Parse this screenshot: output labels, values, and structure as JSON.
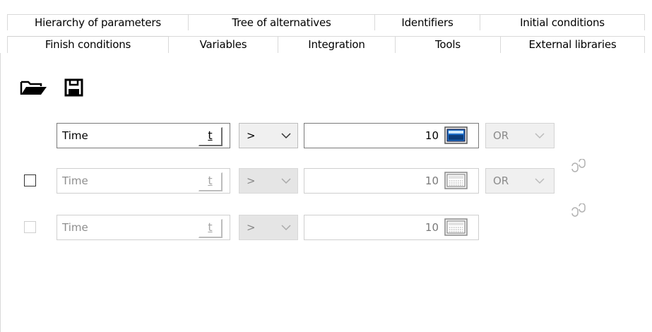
{
  "tabs": {
    "row1": [
      {
        "label": "Hierarchy of parameters"
      },
      {
        "label": "Tree of alternatives"
      },
      {
        "label": "Identifiers"
      },
      {
        "label": "Initial conditions"
      }
    ],
    "row2": [
      {
        "label": "Finish conditions",
        "active": true
      },
      {
        "label": "Variables"
      },
      {
        "label": "Integration"
      },
      {
        "label": "Tools"
      },
      {
        "label": "External libraries"
      }
    ]
  },
  "toolbar": {
    "open_icon": "open-folder-icon",
    "save_icon": "save-disk-icon"
  },
  "conditions": [
    {
      "checkbox_shown": false,
      "variable": "Time",
      "var_button": "t",
      "operator": "&gt;",
      "value": "10",
      "logic": "OR",
      "enabled": true
    },
    {
      "checkbox_shown": true,
      "checked": false,
      "variable": "Time",
      "var_button": "t",
      "operator": "&gt;",
      "value": "10",
      "logic": "OR",
      "enabled": false
    },
    {
      "checkbox_shown": true,
      "checked": false,
      "variable": "Time",
      "var_button": "t",
      "operator": "&gt;",
      "value": "10",
      "enabled": false
    }
  ],
  "colors": {
    "calculator_active": "#1f6fc9",
    "disabled_text": "#8e8e8e"
  }
}
